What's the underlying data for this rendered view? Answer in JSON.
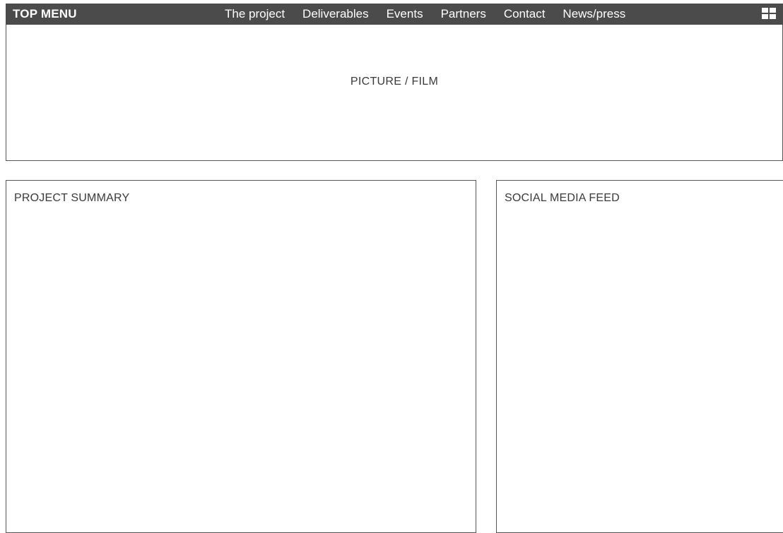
{
  "topbar": {
    "title": "TOP MENU",
    "grid_icon": "grid-icon"
  },
  "nav": {
    "items": [
      "The project",
      "Deliverables",
      "Events",
      "Partners",
      "Contact",
      "News/press"
    ]
  },
  "hero": {
    "label": "PICTURE / FILM"
  },
  "panels": {
    "summary_title": "PROJECT SUMMARY",
    "social_title": "SOCIAL MEDIA FEED"
  },
  "colors": {
    "topbar_bg": "#4b4b4b",
    "border": "#555555",
    "text": "#3a3a3a"
  }
}
